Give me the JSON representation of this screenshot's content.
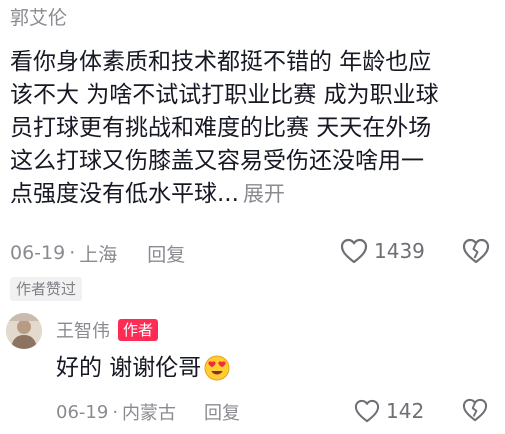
{
  "comment": {
    "author": "郭艾伦",
    "lines": [
      "看你身体素质和技术都挺不错的 年龄也应",
      "该不大 为啥不试试打职业比赛 成为职业球",
      "员打球更有挑战和难度的比赛 天天在外场",
      "这么打球又伤膝盖又容易受伤还没啥用一",
      "点强度没有低水平球..."
    ],
    "expand_label": "展开",
    "date": "06-19",
    "separator": "·",
    "location": "上海",
    "reply_label": "回复",
    "like_count": "1439",
    "badge": "作者赞过"
  },
  "reply": {
    "author": "王智伟",
    "author_tag": "作者",
    "text": "好的 谢谢伦哥",
    "emoji": "heart-eyes-emoji",
    "date": "06-19",
    "separator": "·",
    "location": "内蒙古",
    "reply_label": "回复",
    "like_count": "142"
  },
  "colors": {
    "text": "#161823",
    "muted": "#8a8b91",
    "author_tag": "#fe2c55",
    "badge_bg": "#f1f1f2"
  },
  "icons": {
    "like": "heart-outline-icon",
    "dislike": "broken-heart-outline-icon"
  }
}
